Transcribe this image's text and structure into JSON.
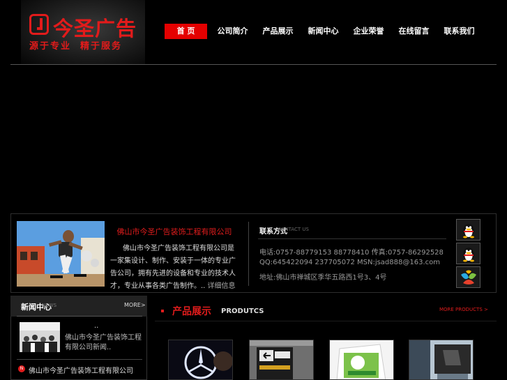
{
  "logo": {
    "name": "今圣广告",
    "slogan": "源于专业  精于服务"
  },
  "nav": {
    "items": [
      {
        "label": "首 页",
        "active": true
      },
      {
        "label": "公司简介"
      },
      {
        "label": "产品展示"
      },
      {
        "label": "新闻中心"
      },
      {
        "label": "企业荣誉"
      },
      {
        "label": "在线留言"
      },
      {
        "label": "联系我们"
      }
    ]
  },
  "about": {
    "title": "佛山市今圣广告装饰工程有限公司",
    "body": "佛山市今圣广告装饰工程有限公司是一家集设计、制作、安装于一体的专业广告公司，拥有先进的设备和专业的技术人才，专业从事各类广告制作。..",
    "more": "详细信息"
  },
  "contact": {
    "heading": "联系方式",
    "heading_en": "CONTACT US",
    "phone": "电话:0757-88779153  88778410  传真:0757-86292528",
    "qq": "QQ:645422094  237705072  MSN:jsad888@163.com",
    "address": "地址:佛山市禅城区季华五路西1号3、4号"
  },
  "im_icons": [
    "qq-icon",
    "qq-icon",
    "msn-icon"
  ],
  "news": {
    "title": "新闻中心",
    "title_en": "NEWS",
    "more": "MORE>",
    "featured_title": "..",
    "featured_body": "佛山市今圣广告装饰工程有限公司新闻..",
    "items": [
      "佛山市今圣广告装饰工程有限公司"
    ],
    "badge": "N"
  },
  "products": {
    "title": "产品展示",
    "title_en": "PRODUTCS",
    "more": "MORE PRODUCTS >"
  },
  "colors": {
    "accent": "#e01c1c",
    "background": "#000000"
  }
}
